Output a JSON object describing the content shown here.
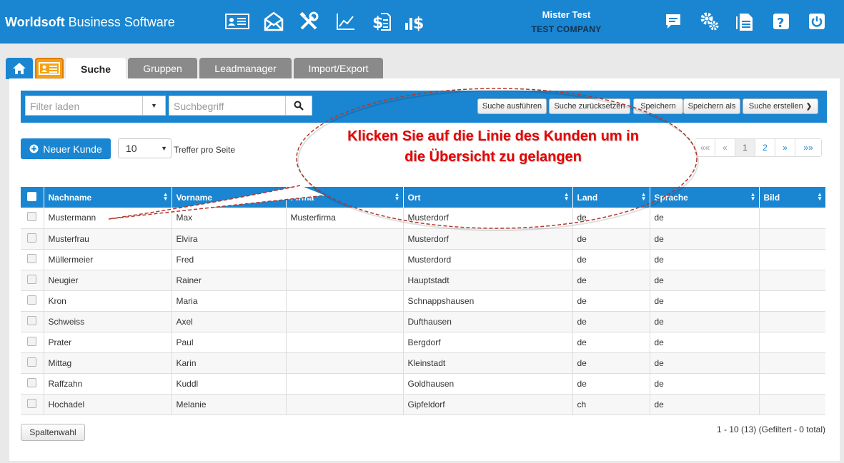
{
  "header": {
    "brand_bold": "Worldsoft",
    "brand_rest": " Business Software",
    "user_name": "Mister Test",
    "company": "TEST COMPANY",
    "nav_icons": [
      "contacts-card-icon",
      "mail-icon",
      "tools-icon",
      "chart-icon",
      "invoice-icon",
      "dollar-chart-icon"
    ],
    "right_icons": [
      "chat-icon",
      "settings-icon",
      "documents-icon",
      "help-icon",
      "power-icon"
    ]
  },
  "tabs": {
    "home_icon": "home-icon",
    "contacts_icon": "contacts-card-icon",
    "items": [
      "Suche",
      "Gruppen",
      "Leadmanager",
      "Import/Export"
    ],
    "active": "Suche"
  },
  "toolbar": {
    "filter_placeholder": "Filter laden",
    "search_placeholder": "Suchbegriff",
    "execute": "Suche ausführen",
    "reset": "Suche zurücksetzen",
    "save": "Speichern",
    "save_as": "Speichern als",
    "create": "Suche erstellen"
  },
  "controls": {
    "new_customer": "Neuer Kunde",
    "per_page_value": "10",
    "per_page_label": "Treffer pro Seite"
  },
  "pager": [
    "««",
    "«",
    "1",
    "2",
    "»",
    "»»"
  ],
  "table": {
    "columns": [
      "Nachname",
      "Vorname",
      "Firma",
      "Ort",
      "Land",
      "Sprache",
      "Bild"
    ],
    "rows": [
      [
        "Mustermann",
        "Max",
        "Musterfirma",
        "Musterdorf",
        "de",
        "de",
        ""
      ],
      [
        "Musterfrau",
        "Elvira",
        "",
        "Musterdorf",
        "de",
        "de",
        ""
      ],
      [
        "Müllermeier",
        "Fred",
        "",
        "Musterdord",
        "de",
        "de",
        ""
      ],
      [
        "Neugier",
        "Rainer",
        "",
        "Hauptstadt",
        "de",
        "de",
        ""
      ],
      [
        "Kron",
        "Maria",
        "",
        "Schnappshausen",
        "de",
        "de",
        ""
      ],
      [
        "Schweiss",
        "Axel",
        "",
        "Dufthausen",
        "de",
        "de",
        ""
      ],
      [
        "Prater",
        "Paul",
        "",
        "Bergdorf",
        "de",
        "de",
        ""
      ],
      [
        "Mittag",
        "Karin",
        "",
        "Kleinstadt",
        "de",
        "de",
        ""
      ],
      [
        "Raffzahn",
        "Kuddl",
        "",
        "Goldhausen",
        "de",
        "de",
        ""
      ],
      [
        "Hochadel",
        "Melanie",
        "",
        "Gipfeldorf",
        "ch",
        "de",
        ""
      ]
    ]
  },
  "footer": {
    "column_select": "Spaltenwahl",
    "status": "1 - 10 (13) (Gefiltert - 0 total)"
  },
  "callout": {
    "text": "Klicken Sie auf die Linie des Kunden um in die Übersicht zu gelangen",
    "color": "#e60000"
  }
}
